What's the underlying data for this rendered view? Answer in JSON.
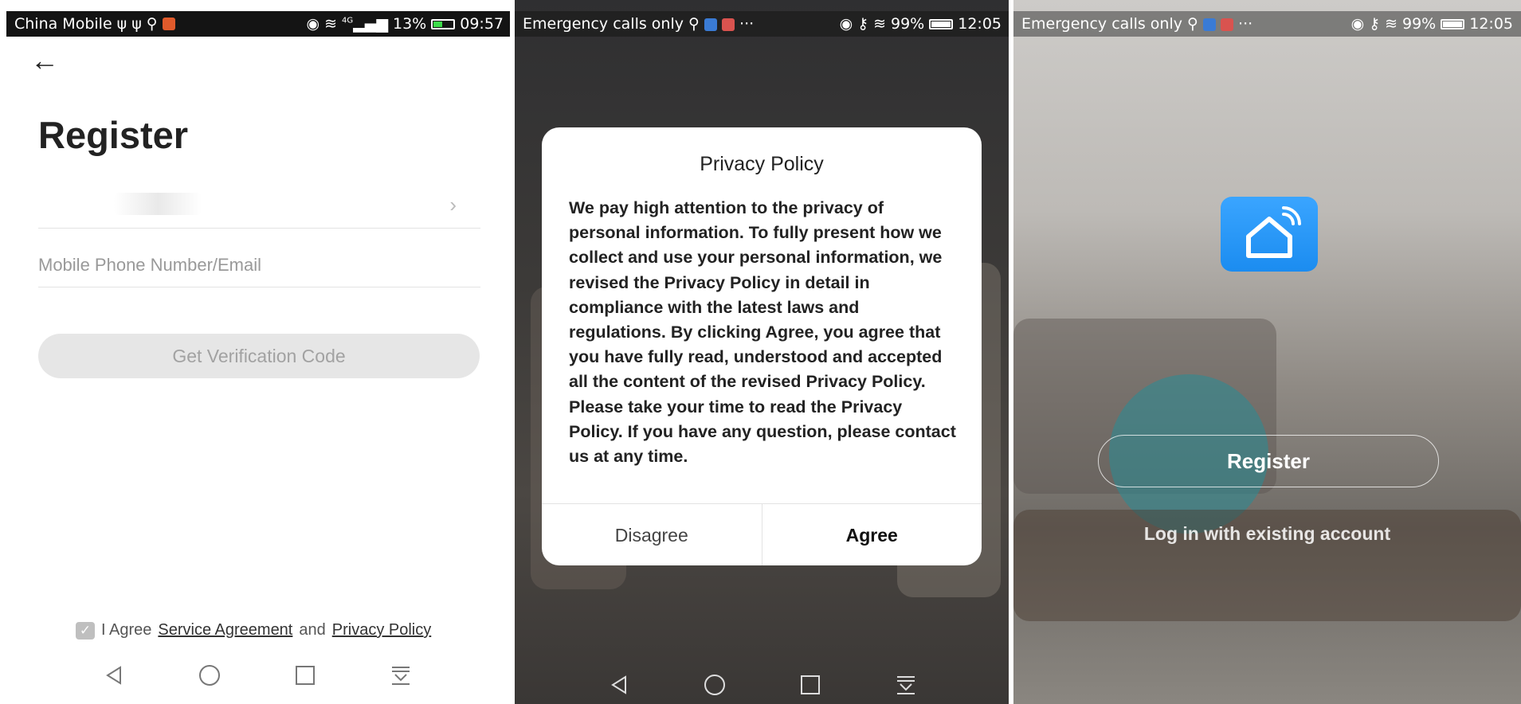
{
  "screen1": {
    "status": {
      "carrier": "China Mobile",
      "battery": "13%",
      "time": "09:57",
      "signal": "4G"
    },
    "title": "Register",
    "phone_placeholder": "Mobile Phone Number/Email",
    "verify_button": "Get Verification Code",
    "agreement": {
      "prefix": "I Agree",
      "service": "Service Agreement",
      "conj": "and",
      "privacy": "Privacy Policy"
    }
  },
  "screen2": {
    "status": {
      "carrier": "Emergency calls only",
      "battery": "99%",
      "time": "12:05"
    },
    "dialog": {
      "title": "Privacy Policy",
      "body": "We pay high attention to the privacy of personal information. To fully present how we collect and use your personal information, we revised the Privacy Policy in detail in compliance with the latest laws and regulations. By clicking Agree, you agree that you have fully read, understood and accepted all the content of the revised Privacy Policy. Please take your time to read the Privacy Policy. If you have any question, please contact us at any time.",
      "disagree": "Disagree",
      "agree": "Agree"
    }
  },
  "screen3": {
    "status": {
      "carrier": "Emergency calls only",
      "battery": "99%",
      "time": "12:05"
    },
    "register_button": "Register",
    "login_link": "Log in with existing account"
  },
  "colors": {
    "accent": "#1b8cf0",
    "disabled_button": "#e6e6e6"
  }
}
